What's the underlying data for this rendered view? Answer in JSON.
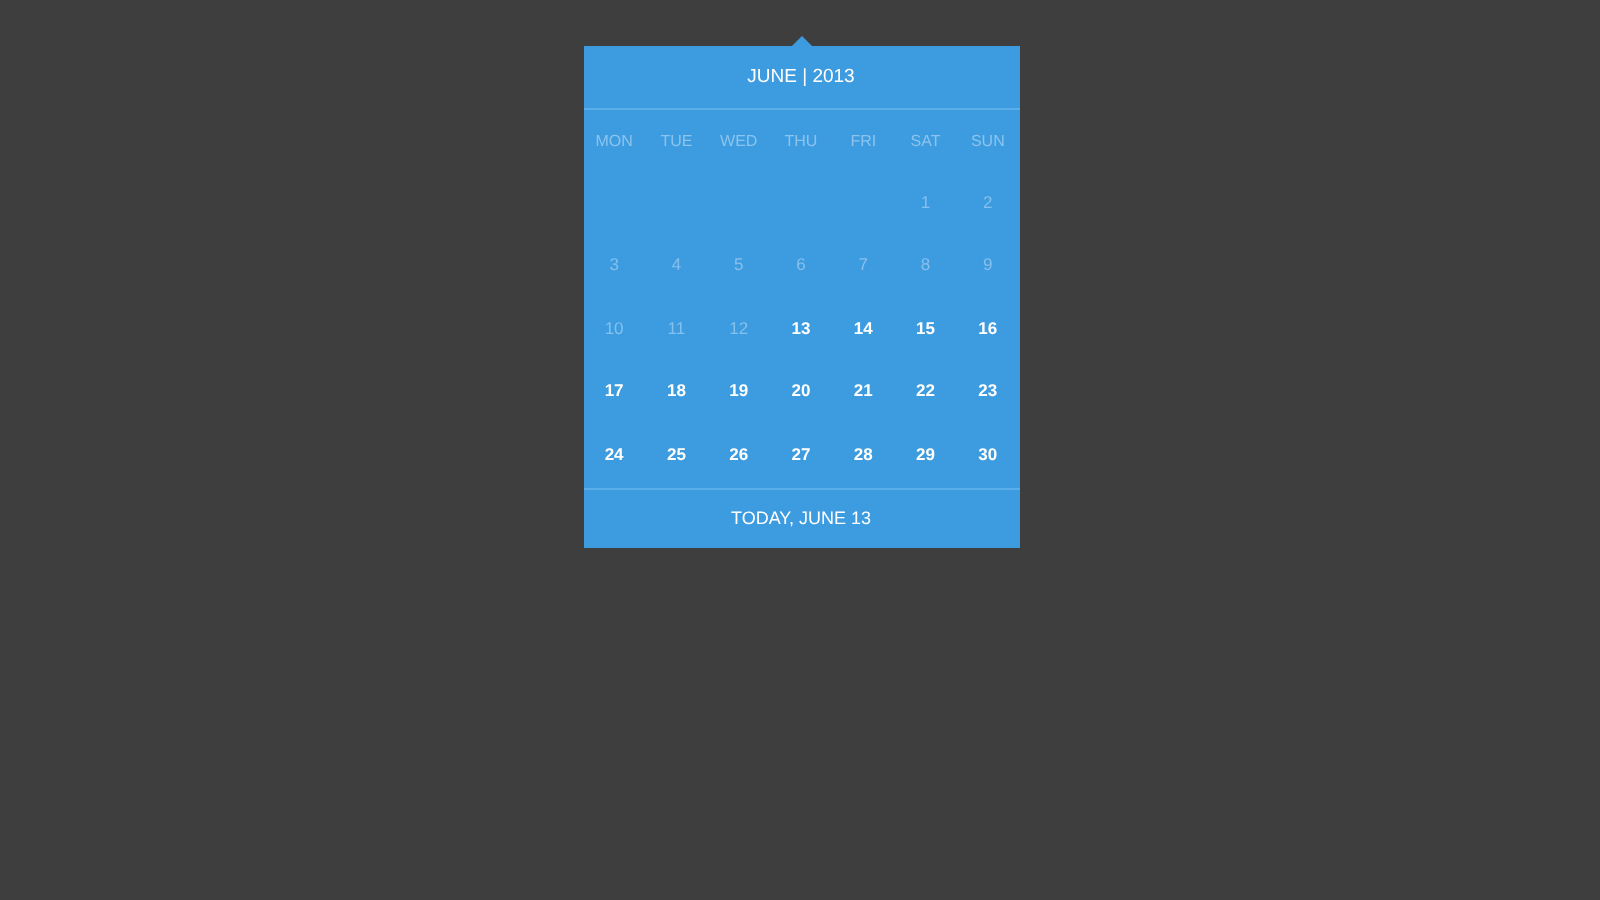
{
  "calendar": {
    "title": "JUNE | 2013",
    "weekdays": [
      "MON",
      "TUE",
      "WED",
      "THU",
      "FRI",
      "SAT",
      "SUN"
    ],
    "weeks": [
      [
        {
          "label": "1",
          "muted": true
        },
        {
          "label": "2",
          "muted": true
        }
      ],
      [
        {
          "label": "3",
          "muted": true
        },
        {
          "label": "4",
          "muted": true
        },
        {
          "label": "5",
          "muted": true
        },
        {
          "label": "6",
          "muted": true
        },
        {
          "label": "7",
          "muted": true
        },
        {
          "label": "8",
          "muted": true
        },
        {
          "label": "9",
          "muted": true
        }
      ],
      [
        {
          "label": "10",
          "muted": true
        },
        {
          "label": "11",
          "muted": true
        },
        {
          "label": "12",
          "muted": true
        },
        {
          "label": "13",
          "muted": false
        },
        {
          "label": "14",
          "muted": false
        },
        {
          "label": "15",
          "muted": false
        },
        {
          "label": "16",
          "muted": false
        }
      ],
      [
        {
          "label": "17",
          "muted": false
        },
        {
          "label": "18",
          "muted": false
        },
        {
          "label": "19",
          "muted": false
        },
        {
          "label": "20",
          "muted": false
        },
        {
          "label": "21",
          "muted": false
        },
        {
          "label": "22",
          "muted": false
        },
        {
          "label": "23",
          "muted": false
        }
      ],
      [
        {
          "label": "24",
          "muted": false
        },
        {
          "label": "25",
          "muted": false
        },
        {
          "label": "26",
          "muted": false
        },
        {
          "label": "27",
          "muted": false
        },
        {
          "label": "28",
          "muted": false
        },
        {
          "label": "29",
          "muted": false
        },
        {
          "label": "30",
          "muted": false
        }
      ]
    ],
    "footer": "TODAY, JUNE 13"
  }
}
